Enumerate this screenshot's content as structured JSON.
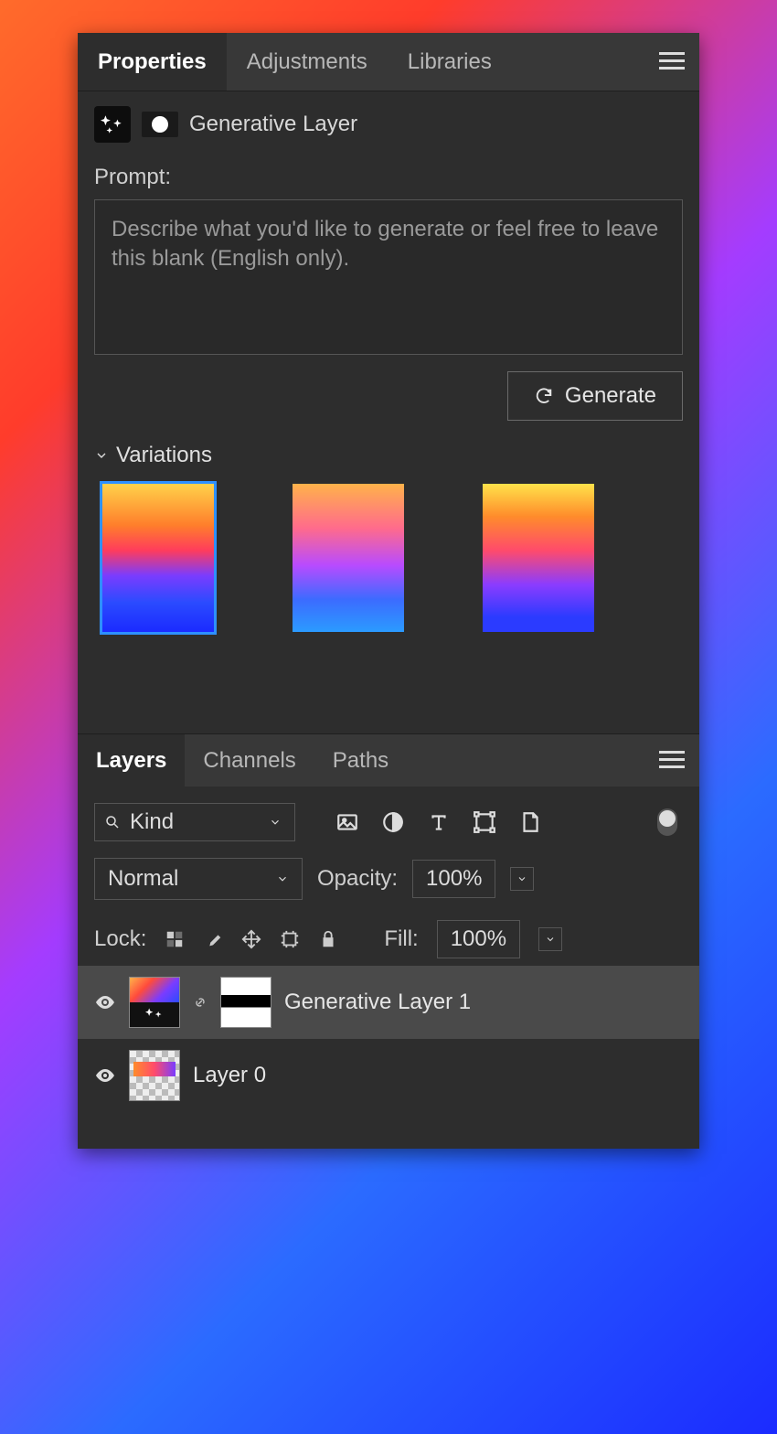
{
  "top_tabs": {
    "properties": "Properties",
    "adjustments": "Adjustments",
    "libraries": "Libraries"
  },
  "header": {
    "title": "Generative Layer"
  },
  "prompt": {
    "label": "Prompt:",
    "placeholder": "Describe what you'd like to generate or feel free to leave this blank (English only)."
  },
  "generate": {
    "label": "Generate"
  },
  "variations": {
    "label": "Variations"
  },
  "layers_tabs": {
    "layers": "Layers",
    "channels": "Channels",
    "paths": "Paths"
  },
  "filter": {
    "kind": "Kind"
  },
  "blend": {
    "mode": "Normal",
    "opacity_label": "Opacity:",
    "opacity_value": "100%"
  },
  "lock": {
    "label": "Lock:",
    "fill_label": "Fill:",
    "fill_value": "100%"
  },
  "layers": [
    {
      "name": "Generative Layer 1"
    },
    {
      "name": "Layer 0"
    }
  ]
}
